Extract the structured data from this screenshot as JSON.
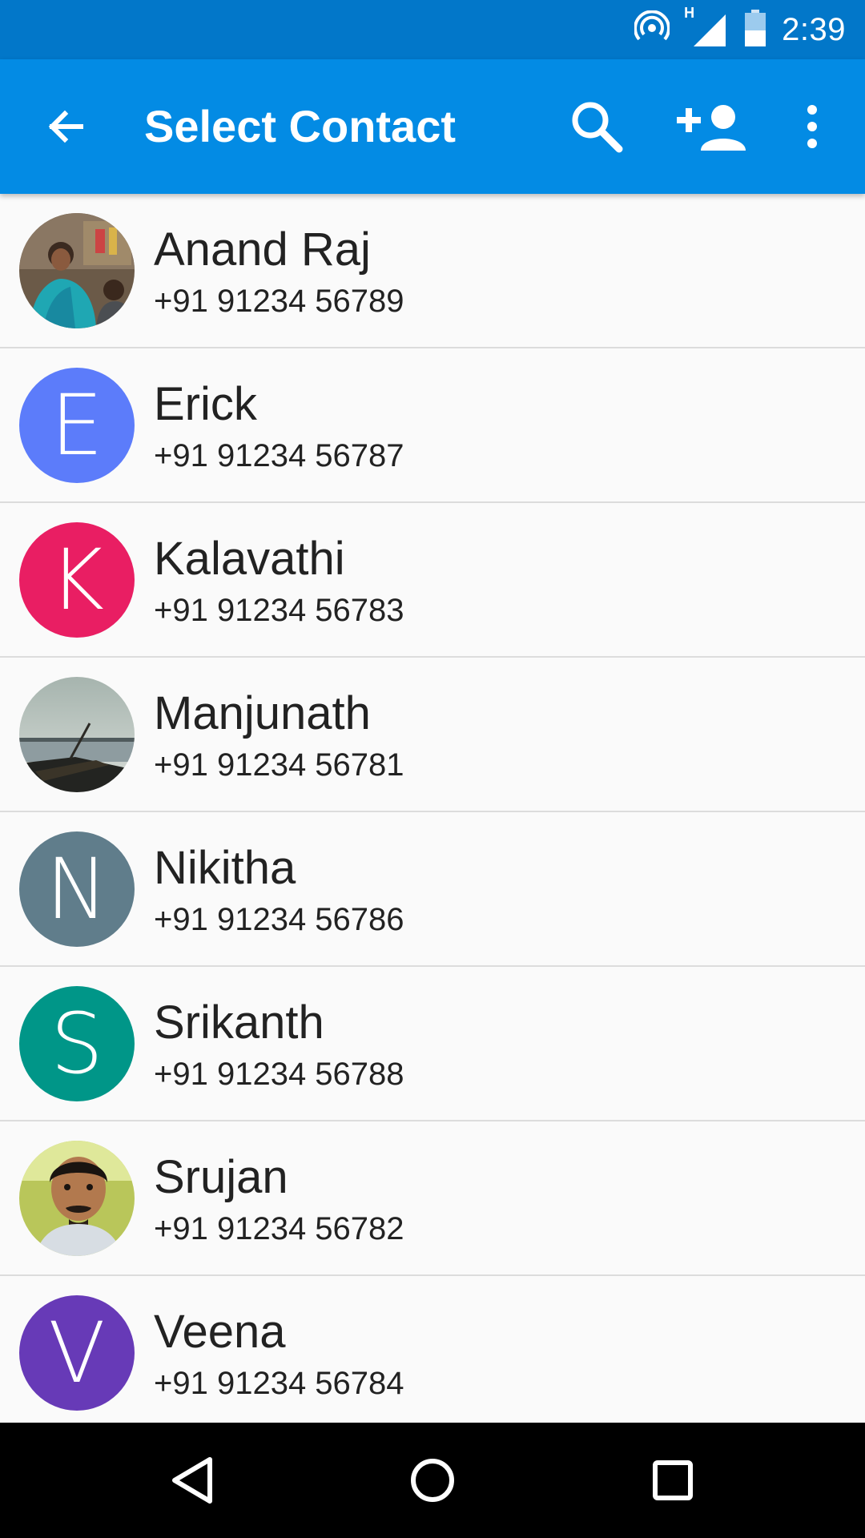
{
  "status_bar": {
    "time": "2:39",
    "network": "H",
    "icons": [
      "hotspot-icon",
      "signal-icon",
      "battery-icon"
    ]
  },
  "app_bar": {
    "title": "Select Contact",
    "actions": [
      "back-arrow-icon",
      "search-icon",
      "add-person-icon",
      "more-vert-icon"
    ],
    "color": "#038be4"
  },
  "contacts": [
    {
      "name": "Anand Raj",
      "phone": "+91 91234 56789",
      "avatar": "photo"
    },
    {
      "name": "Erick",
      "phone": "+91 91234 56787",
      "avatar": "letter",
      "letter": "E",
      "color": "#5c7cfa"
    },
    {
      "name": "Kalavathi",
      "phone": "+91 91234 56783",
      "avatar": "letter",
      "letter": "K",
      "color": "#e91e63"
    },
    {
      "name": "Manjunath",
      "phone": "+91 91234 56781",
      "avatar": "photo"
    },
    {
      "name": "Nikitha",
      "phone": "+91 91234 56786",
      "avatar": "letter",
      "letter": "N",
      "color": "#607d8b"
    },
    {
      "name": "Srikanth",
      "phone": "+91 91234 56788",
      "avatar": "letter",
      "letter": "S",
      "color": "#009688"
    },
    {
      "name": "Srujan",
      "phone": "+91 91234 56782",
      "avatar": "photo"
    },
    {
      "name": "Veena",
      "phone": "+91 91234 56784",
      "avatar": "letter",
      "letter": "V",
      "color": "#673ab7"
    }
  ],
  "nav_bar": [
    "back-triangle-icon",
    "home-circle-icon",
    "recents-square-icon"
  ]
}
